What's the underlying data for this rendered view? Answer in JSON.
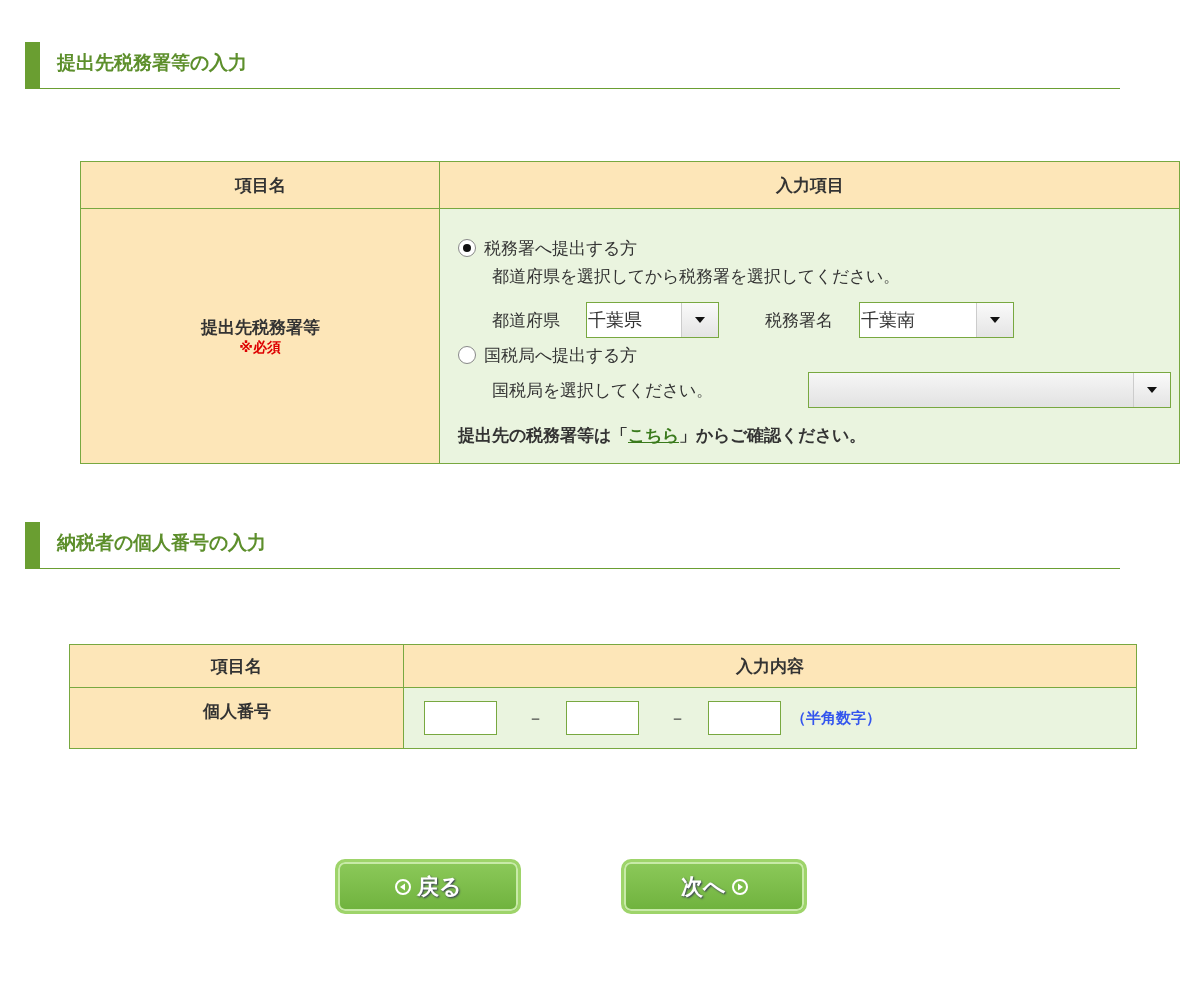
{
  "sections": [
    {
      "title": "提出先税務署等の入力",
      "kind": "office",
      "header": [
        "項目名",
        "入力項目"
      ],
      "label": "提出先税務署等",
      "required": "※必須",
      "options": [
        {
          "label": "税務署へ提出する方",
          "selected": true,
          "hint": "都道府県を選択してから税務署を選択してください。",
          "selects": [
            {
              "label": "都道府県",
              "value": "千葉県"
            },
            {
              "label": "税務署名",
              "value": "千葉南"
            }
          ]
        },
        {
          "label": "国税局へ提出する方",
          "selected": false,
          "hint": "国税局を選択してください。",
          "selects": [
            {
              "kind": "empty"
            }
          ]
        }
      ],
      "note": {
        "before": "提出先の税務署等は「",
        "link": "こちら",
        "after": "」からご確認ください。"
      }
    },
    {
      "title": "納税者の個人番号の入力",
      "kind": "number",
      "header": [
        "項目名",
        "入力内容"
      ],
      "label": "個人番号",
      "separator": "－",
      "fields": [
        {
          "kind": "box"
        },
        {
          "kind": "box"
        },
        {
          "kind": "box"
        }
      ],
      "hint": "（半角数字）"
    }
  ],
  "buttons": [
    {
      "label": "戻る",
      "kind": "back"
    },
    {
      "label": "次へ",
      "kind": "next"
    }
  ]
}
